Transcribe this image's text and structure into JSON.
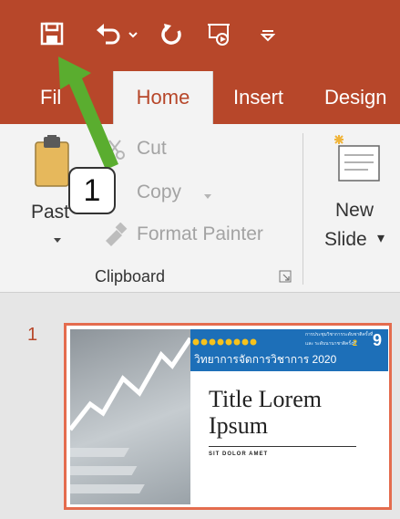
{
  "quick_access": {
    "icons": [
      "save-icon",
      "undo-icon",
      "undo-dropdown-icon",
      "redo-icon",
      "presenter-icon",
      "customize-qat-icon"
    ]
  },
  "tabs": [
    {
      "label": "File",
      "visible_text": "Fil"
    },
    {
      "label": "Home",
      "active": true
    },
    {
      "label": "Insert"
    },
    {
      "label": "Design"
    }
  ],
  "clipboard": {
    "paste_label": "Paste",
    "paste_visible": "Past",
    "cut_label": "Cut",
    "copy_label": "Copy",
    "format_painter_label": "Format Painter",
    "group_label": "Clipboard"
  },
  "slides": {
    "new_slide_line1": "New",
    "new_slide_line2": "Slide",
    "new_slide_dropdown": "▾"
  },
  "slide_panel": {
    "slide_number": "1",
    "thumb_title_line1": "Title Lorem",
    "thumb_title_line2": "Ipsum",
    "thumb_subtitle": "SIT DOLOR AMET",
    "banner_main": "วิทยาการจัดการวิชาการ 2020",
    "banner_small_1": "การประชุมวิชาการระดับชาติครั้งที่",
    "banner_small_2": "และ ระดับนานาชาติครั้งที่",
    "banner_num_1": "9",
    "banner_num_2": "2"
  },
  "annotation": {
    "callout_number": "1"
  },
  "colors": {
    "accent": "#b7472a",
    "ribbon_bg": "#f3f3f3",
    "thumb_border": "#e46c4e",
    "arrow": "#5aad2f",
    "banner": "#1d6fb8"
  }
}
